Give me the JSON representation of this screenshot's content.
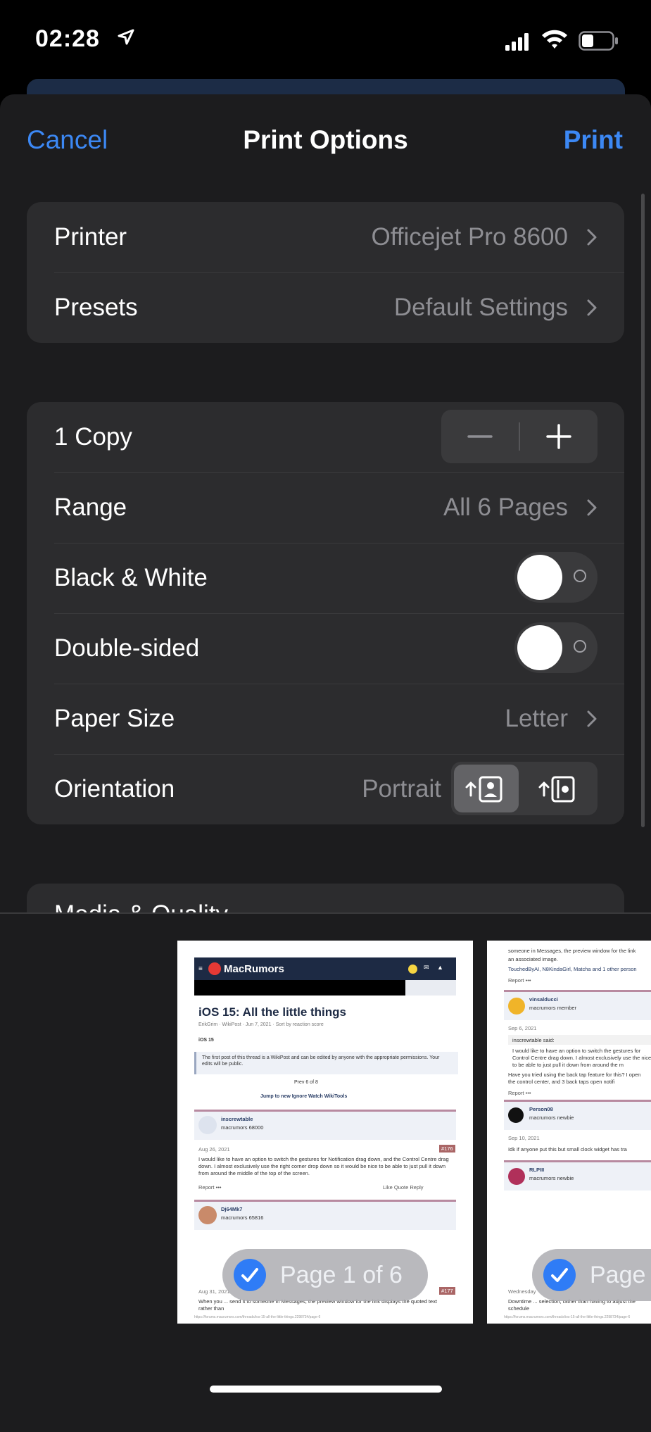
{
  "status_bar": {
    "time": "02:28"
  },
  "nav": {
    "cancel": "Cancel",
    "title": "Print Options",
    "print": "Print"
  },
  "printer_group": {
    "printer_label": "Printer",
    "printer_value": "Officejet Pro 8600",
    "presets_label": "Presets",
    "presets_value": "Default Settings"
  },
  "options_group": {
    "copies_label": "1 Copy",
    "range_label": "Range",
    "range_value": "All 6 Pages",
    "bw_label": "Black & White",
    "bw_on": false,
    "duplex_label": "Double-sided",
    "duplex_on": false,
    "paper_label": "Paper Size",
    "paper_value": "Letter",
    "orientation_label": "Orientation",
    "orientation_value": "Portrait"
  },
  "media_group": {
    "label": "Media & Quality"
  },
  "preview": {
    "page1": {
      "site": "MacRumors",
      "thread_title": "iOS 15: All the little things",
      "meta": "ErikGrim · WikiPost · Jun 7, 2021 · Sort by reaction score",
      "breadcrumb": "iOS 15",
      "notice": "The first post of this thread is a WikiPost and can be edited by anyone with the appropriate permissions. Your edits will be public.",
      "pager": "Prev   6 of 8",
      "actions": "Jump to new    Ignore    Watch    WikiTools",
      "user1": "inscrewtable",
      "user1_rank": "macrumors 68000",
      "date1": "Aug 26, 2021",
      "post1_num": "#176",
      "post1_text": "I would like to have an option to switch the gestures for Notification drag down, and the Control Centre drag down. I almost exclusively use the right corner drop down so it would be nice to be able to just pull it down from around the middle of the top of the screen.",
      "post_actions": "Report   •••",
      "post_reacts": "Like   Quote   Reply",
      "user2": "Dj64Mk7",
      "user2_rank": "macrumors 65816",
      "date2": "Aug 31, 2021",
      "post2_num": "#177",
      "post2_text": "When you ... send it to someone in Messages, the preview window for the link displays the quoted text rather than",
      "footer_url": "https://forums.macrumors.com/threads/ios-15-all-the-little-things.2298734/page-6"
    },
    "page2": {
      "top_text": "someone in Messages, the preview window for the link",
      "top_text2": "an associated image.",
      "likes": "TouchedByAI, N8KindaGirl, Matcha and 1 other person",
      "user1": "vinsalducci",
      "user1_rank": "macrumors member",
      "date1": "Sep 6, 2021",
      "quote_author": "inscrewtable said:",
      "quote_text": "I would like to have an option to switch the gestures for Control Centre drag down. I almost exclusively use the nice to be able to just pull it down from around the m",
      "reply": "Have you tried using the back tap feature for this? I open the control center, and 3 back taps open notifi",
      "user2": "Person08",
      "user2_rank": "macrumors newbie",
      "date2": "Sep 10, 2021",
      "post2_text": "Idk if anyone put this but small clock widget has tra",
      "user3": "RLPIII",
      "user3_rank": "macrumors newbie",
      "date3": "Wednesday",
      "post3_text": "Downtime ... selection, rather than having to adjust the schedule",
      "footer_url": "https://forums.macrumors.com/threads/ios-15-all-the-little-things.2298734/page-6"
    },
    "pill1": "Page 1 of 6",
    "pill2": "Page"
  },
  "colors": {
    "accent": "#3c88f4",
    "sheet": "#1c1c1e",
    "group": "#2c2c2e"
  },
  "icons": [
    "location-arrow-icon",
    "signal-icon",
    "wifi-icon",
    "battery-icon",
    "chevron-right-icon",
    "minus-icon",
    "plus-icon",
    "portrait-icon",
    "landscape-icon",
    "checkmark-icon"
  ]
}
